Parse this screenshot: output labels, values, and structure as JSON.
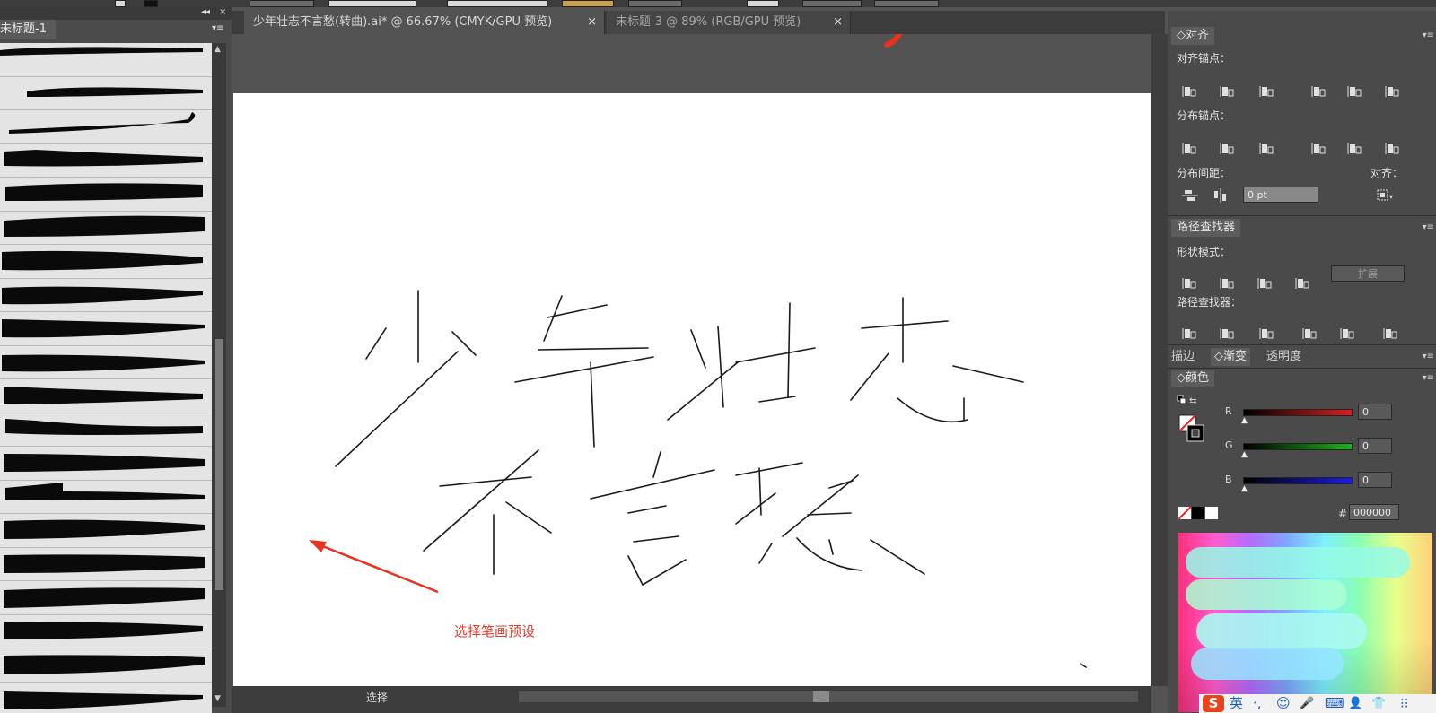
{
  "brush_panel": {
    "tab_label": "未标题-1",
    "collapse_glyph": "◂◂",
    "close_glyph": "×",
    "menu_glyph": "▾≡",
    "brush_count": 20
  },
  "doc_tabs": [
    {
      "label": "少年壮志不言愁(转曲).ai* @ 66.67% (CMYK/GPU 预览)",
      "close": "×",
      "active": true
    },
    {
      "label": "未标题-3 @ 89% (RGB/GPU 预览)",
      "close": "×",
      "active": false
    }
  ],
  "canvas": {
    "annotation": "选择笔画预设",
    "annotation_color": "#e23a2a"
  },
  "status_bar": {
    "tool_label": "选择"
  },
  "align_panel": {
    "title": "◇对齐",
    "align_anchor_label": "对齐锚点：",
    "distribute_anchor_label": "分布锚点：",
    "distribute_spacing_label": "分布间距：",
    "align_to_label": "对齐：",
    "spacing_value": "0 pt"
  },
  "pathfinder_panel": {
    "title": "路径查找器",
    "shape_modes_label": "形状模式：",
    "expand_label": "扩展",
    "pathfinders_label": "路径查找器："
  },
  "stroke_tabs": [
    {
      "label": "描边"
    },
    {
      "label": "◇渐变"
    },
    {
      "label": "透明度"
    }
  ],
  "color_panel": {
    "title": "◇颜色",
    "channels": [
      {
        "name": "R",
        "value": "0",
        "color": "#e01c1c"
      },
      {
        "name": "G",
        "value": "0",
        "color": "#1cb41c"
      },
      {
        "name": "B",
        "value": "0",
        "color": "#1c1ce0"
      }
    ],
    "hex_prefix": "#",
    "hex_value": "000000"
  },
  "ime_bar": {
    "logo": "S",
    "mode": "英",
    "glyphs": [
      "·,",
      "☺",
      "🎤",
      "⌨",
      "👤",
      "👕",
      "⁝⁝"
    ]
  }
}
